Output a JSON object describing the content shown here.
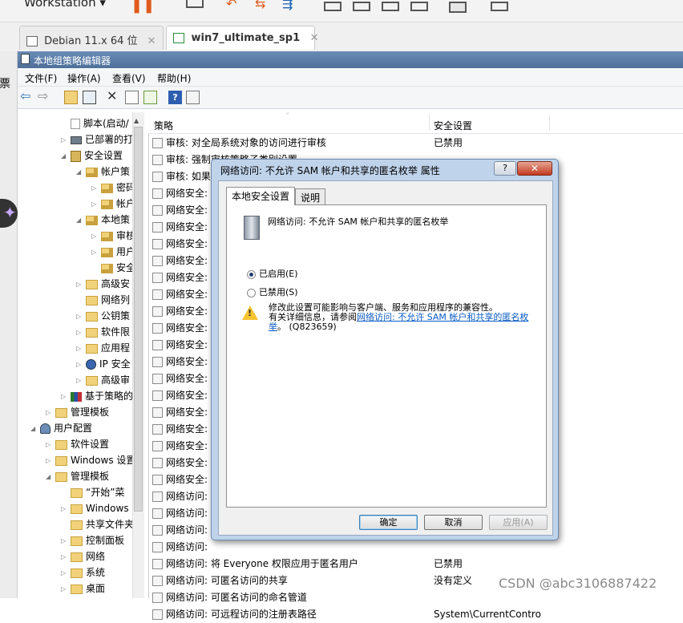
{
  "vmware": {
    "title": "Workstation ▾",
    "tabs": [
      {
        "label": "Debian 11.x 64 位",
        "close": "✕"
      },
      {
        "label": "win7_ultimate_sp1",
        "close": "✕"
      }
    ],
    "side_labels": [
      "票"
    ]
  },
  "gpedit": {
    "title": "本地组策略编辑器",
    "menus": [
      "文件(F)",
      "操作(A)",
      "查看(V)",
      "帮助(H)"
    ]
  },
  "tree": [
    {
      "label": "脚本(启动/",
      "indent": 3,
      "arrow": "",
      "icon": "doc"
    },
    {
      "label": "已部署的打",
      "indent": 3,
      "arrow": "▷",
      "icon": "printer"
    },
    {
      "label": "安全设置",
      "indent": 3,
      "arrow": "◢",
      "icon": "shield"
    },
    {
      "label": "帐户策",
      "indent": 4,
      "arrow": "◢",
      "icon": "lockfold"
    },
    {
      "label": "密码",
      "indent": 5,
      "arrow": "▷",
      "icon": "lockfold"
    },
    {
      "label": "帐户",
      "indent": 5,
      "arrow": "▷",
      "icon": "lockfold"
    },
    {
      "label": "本地策",
      "indent": 4,
      "arrow": "◢",
      "icon": "lockfold"
    },
    {
      "label": "审核",
      "indent": 5,
      "arrow": "▷",
      "icon": "lockfold"
    },
    {
      "label": "用户",
      "indent": 5,
      "arrow": "▷",
      "icon": "lockfold"
    },
    {
      "label": "安全",
      "indent": 5,
      "arrow": "",
      "icon": "lockfold"
    },
    {
      "label": "高级安",
      "indent": 4,
      "arrow": "▷",
      "icon": "fold"
    },
    {
      "label": "网络列",
      "indent": 4,
      "arrow": "",
      "icon": "fold"
    },
    {
      "label": "公钥策",
      "indent": 4,
      "arrow": "▷",
      "icon": "fold"
    },
    {
      "label": "软件限",
      "indent": 4,
      "arrow": "▷",
      "icon": "fold"
    },
    {
      "label": "应用程",
      "indent": 4,
      "arrow": "▷",
      "icon": "fold"
    },
    {
      "label": "IP 安全",
      "indent": 4,
      "arrow": "▷",
      "icon": "ipsec"
    },
    {
      "label": "高级审",
      "indent": 4,
      "arrow": "▷",
      "icon": "fold"
    },
    {
      "label": "基于策略的",
      "indent": 3,
      "arrow": "▷",
      "icon": "chart"
    },
    {
      "label": "管理模板",
      "indent": 2,
      "arrow": "▷",
      "icon": "fold"
    },
    {
      "label": "用户配置",
      "indent": 1,
      "arrow": "◢",
      "icon": "user"
    },
    {
      "label": "软件设置",
      "indent": 2,
      "arrow": "▷",
      "icon": "fold"
    },
    {
      "label": "Windows 设置",
      "indent": 2,
      "arrow": "▷",
      "icon": "fold"
    },
    {
      "label": "管理模板",
      "indent": 2,
      "arrow": "◢",
      "icon": "fold"
    },
    {
      "label": "“开始”菜",
      "indent": 3,
      "arrow": "",
      "icon": "fold"
    },
    {
      "label": "Windows",
      "indent": 3,
      "arrow": "▷",
      "icon": "fold"
    },
    {
      "label": "共享文件夹",
      "indent": 3,
      "arrow": "",
      "icon": "fold"
    },
    {
      "label": "控制面板",
      "indent": 3,
      "arrow": "▷",
      "icon": "fold"
    },
    {
      "label": "网络",
      "indent": 3,
      "arrow": "▷",
      "icon": "fold"
    },
    {
      "label": "系统",
      "indent": 3,
      "arrow": "▷",
      "icon": "fold"
    },
    {
      "label": "桌面",
      "indent": 3,
      "arrow": "▷",
      "icon": "fold"
    }
  ],
  "list": {
    "col_policy": "策略",
    "col_setting": "安全设置",
    "rows": [
      {
        "policy": "审核: 对全局系统对象的访问进行审核",
        "setting": "已禁用"
      },
      {
        "policy": "审核: 强制审核策略子类别设置",
        "setting": ""
      },
      {
        "policy": "审核: 如果",
        "setting": ""
      },
      {
        "policy": "网络安全: ",
        "setting": ""
      },
      {
        "policy": "网络安全: ",
        "setting": ""
      },
      {
        "policy": "网络安全: ",
        "setting": ""
      },
      {
        "policy": "网络安全: ",
        "setting": ""
      },
      {
        "policy": "网络安全: ",
        "setting": ""
      },
      {
        "policy": "网络安全: ",
        "setting": ""
      },
      {
        "policy": "网络安全: ",
        "setting": ""
      },
      {
        "policy": "网络安全: ",
        "setting": ""
      },
      {
        "policy": "网络安全: ",
        "setting": ""
      },
      {
        "policy": "网络安全: ",
        "setting": ""
      },
      {
        "policy": "网络安全: ",
        "setting": ""
      },
      {
        "policy": "网络安全: ",
        "setting": ""
      },
      {
        "policy": "网络安全: ",
        "setting": ""
      },
      {
        "policy": "网络安全: ",
        "setting": ""
      },
      {
        "policy": "网络安全: ",
        "setting": ""
      },
      {
        "policy": "网络安全: ",
        "setting": ""
      },
      {
        "policy": "网络安全: ",
        "setting": ""
      },
      {
        "policy": "网络安全: ",
        "setting": ""
      },
      {
        "policy": "网络访问: ",
        "setting": ""
      },
      {
        "policy": "网络访问: ",
        "setting": ""
      },
      {
        "policy": "网络访问: ",
        "setting": ""
      },
      {
        "policy": "网络访问: ",
        "setting": ""
      },
      {
        "policy": "网络访问: 将 Everyone 权限应用于匿名用户",
        "setting": "已禁用"
      },
      {
        "policy": "网络访问: 可匿名访问的共享",
        "setting": "没有定义"
      },
      {
        "policy": "网络访问: 可匿名访问的命名管道",
        "setting": ""
      },
      {
        "policy": "网络访问: 可远程访问的注册表路径",
        "setting": "System\\CurrentContro"
      }
    ]
  },
  "dialog": {
    "title": "网络访问: 不允许 SAM 帐户和共享的匿名枚举 属性",
    "help": "?",
    "close": "✕",
    "tabs": [
      "本地安全设置",
      "说明"
    ],
    "policy_name": "网络访问: 不允许 SAM 帐户和共享的匿名枚举",
    "enabled_label": "已启用(E)",
    "disabled_label": "已禁用(S)",
    "selected": "enabled",
    "warning_line1": "修改此设置可能影响与客户端、服务和应用程序的兼容性。",
    "warning_line2_prefix": "有关详细信息，请参阅",
    "warning_link": "网络访问: 不允许 SAM 帐户和共享的匿名枚举",
    "warning_suffix": "。 (Q823659)",
    "ok": "确定",
    "cancel": "取消",
    "apply": "应用(A)"
  },
  "watermark": "CSDN @abc3106887422"
}
